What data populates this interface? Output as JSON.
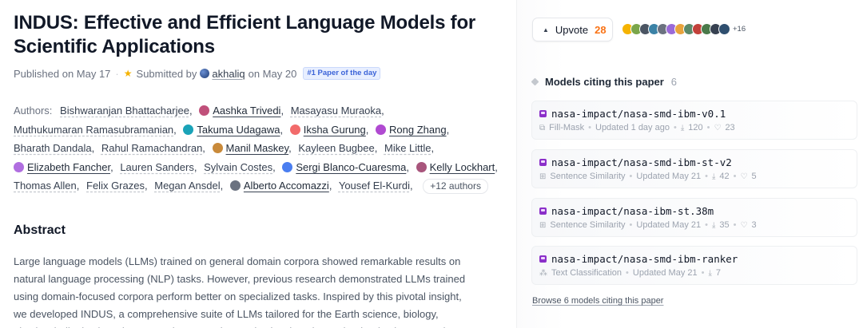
{
  "paper": {
    "title": "INDUS: Effective and Efficient Language Models for Scientific Applications",
    "published": "Published on May 17",
    "submitted_by_label": "Submitted by",
    "submitter": "akhaliq",
    "submitted_on": "on May 20",
    "badge": "#1 Paper of the day"
  },
  "authors": {
    "label": "Authors:",
    "list": [
      {
        "name": "Bishwaranjan Bhattacharjee",
        "avatar": null,
        "linked": false
      },
      {
        "name": "Aashka Trivedi",
        "avatar": "#c0507a",
        "linked": true
      },
      {
        "name": "Masayasu Muraoka",
        "avatar": null,
        "linked": false
      },
      {
        "name": "Muthukumaran Ramasubramanian",
        "avatar": null,
        "linked": false
      },
      {
        "name": "Takuma Udagawa",
        "avatar": "#1aa3b8",
        "linked": true
      },
      {
        "name": "Iksha Gurung",
        "avatar": "#f26b6b",
        "linked": true
      },
      {
        "name": "Rong Zhang",
        "avatar": "#b04ad1",
        "linked": true
      },
      {
        "name": "Bharath Dandala",
        "avatar": null,
        "linked": false
      },
      {
        "name": "Rahul Ramachandran",
        "avatar": null,
        "linked": false
      },
      {
        "name": "Manil Maskey",
        "avatar": "#c98a3a",
        "linked": true
      },
      {
        "name": "Kayleen Bugbee",
        "avatar": null,
        "linked": false
      },
      {
        "name": "Mike Little",
        "avatar": null,
        "linked": false
      },
      {
        "name": "Elizabeth Fancher",
        "avatar": "#b06ee0",
        "linked": true
      },
      {
        "name": "Lauren Sanders",
        "avatar": null,
        "linked": false
      },
      {
        "name": "Sylvain Costes",
        "avatar": null,
        "linked": false
      },
      {
        "name": "Sergi Blanco-Cuaresma",
        "avatar": "#4a7ef0",
        "linked": true
      },
      {
        "name": "Kelly Lockhart",
        "avatar": "#a8557c",
        "linked": true
      },
      {
        "name": "Thomas Allen",
        "avatar": null,
        "linked": false
      },
      {
        "name": "Felix Grazes",
        "avatar": null,
        "linked": false
      },
      {
        "name": "Megan Ansdel",
        "avatar": null,
        "linked": false
      },
      {
        "name": "Alberto Accomazzi",
        "avatar": "#6b7280",
        "linked": true
      },
      {
        "name": "Yousef El-Kurdi",
        "avatar": null,
        "linked": false
      }
    ],
    "more": "+12 authors"
  },
  "abstract": {
    "heading": "Abstract",
    "text": "Large language models (LLMs) trained on general domain corpora showed remarkable results on natural language processing (NLP) tasks. However, previous research demonstrated LLMs trained using domain-focused corpora perform better on specialized tasks. Inspired by this pivotal insight, we developed INDUS, a comprehensive suite of LLMs tailored for the Earth science, biology, physics, heliophysics, planetary sciences and astrophysics domains and trained using curated"
  },
  "upvote": {
    "label": "Upvote",
    "count": "28",
    "more_voters": "+16"
  },
  "voter_colors": [
    "#f5b301",
    "#7aa64a",
    "#4b5563",
    "#3b82a6",
    "#6b7280",
    "#9a6ad8",
    "#e8a33c",
    "#5b8a6a",
    "#c2413a",
    "#4a7a4a",
    "#374151",
    "#2f4f6f"
  ],
  "models": {
    "heading": "Models citing this paper",
    "count": "6",
    "items": [
      {
        "name": "nasa-impact/nasa-smd-ibm-v0.1",
        "task_icon": "fill-mask-icon",
        "task_glyph": "⧉",
        "task": "Fill-Mask",
        "updated": "Updated 1 day ago",
        "downloads": "120",
        "likes": "23"
      },
      {
        "name": "nasa-impact/nasa-smd-ibm-st-v2",
        "task_icon": "sentence-similarity-icon",
        "task_glyph": "⊞",
        "task": "Sentence Similarity",
        "updated": "Updated May 21",
        "downloads": "42",
        "likes": "5"
      },
      {
        "name": "nasa-impact/nasa-ibm-st.38m",
        "task_icon": "sentence-similarity-icon",
        "task_glyph": "⊞",
        "task": "Sentence Similarity",
        "updated": "Updated May 21",
        "downloads": "35",
        "likes": "3"
      },
      {
        "name": "nasa-impact/nasa-smd-ibm-ranker",
        "task_icon": "text-classification-icon",
        "task_glyph": "⁂",
        "task": "Text Classification",
        "updated": "Updated May 21",
        "downloads": "7",
        "likes": null
      }
    ],
    "browse": "Browse 6 models citing this paper"
  }
}
